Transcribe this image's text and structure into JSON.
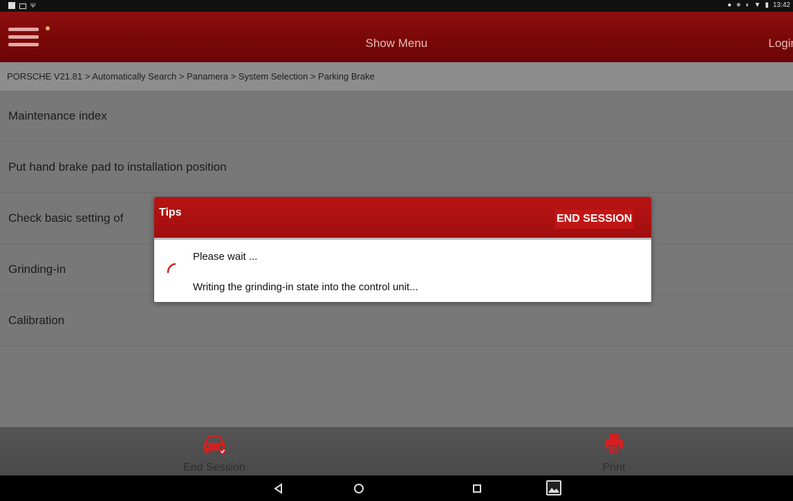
{
  "status_bar": {
    "time": "13:42"
  },
  "header": {
    "title": "Show Menu",
    "login": "Login"
  },
  "breadcrumb": "PORSCHE V21.81 > Automatically Search > Panamera > System Selection > Parking Brake",
  "menu_items": [
    "Maintenance index",
    "Put hand brake pad to installation position",
    "Check basic setting of",
    "Grinding-in",
    "Calibration"
  ],
  "dialog": {
    "title": "Tips",
    "end_button": "END SESSION",
    "message": "Please wait ...",
    "detail": "Writing the grinding-in state into the control unit..."
  },
  "toolbar": {
    "end_session": "End Session",
    "print": "Print"
  },
  "colors": {
    "header_red": "#7a0808",
    "dialog_red": "#b81414",
    "accent_red": "#d42020"
  },
  "icons": {
    "menu": "hamburger-icon",
    "end_session": "car-icon",
    "print": "printer-icon"
  }
}
